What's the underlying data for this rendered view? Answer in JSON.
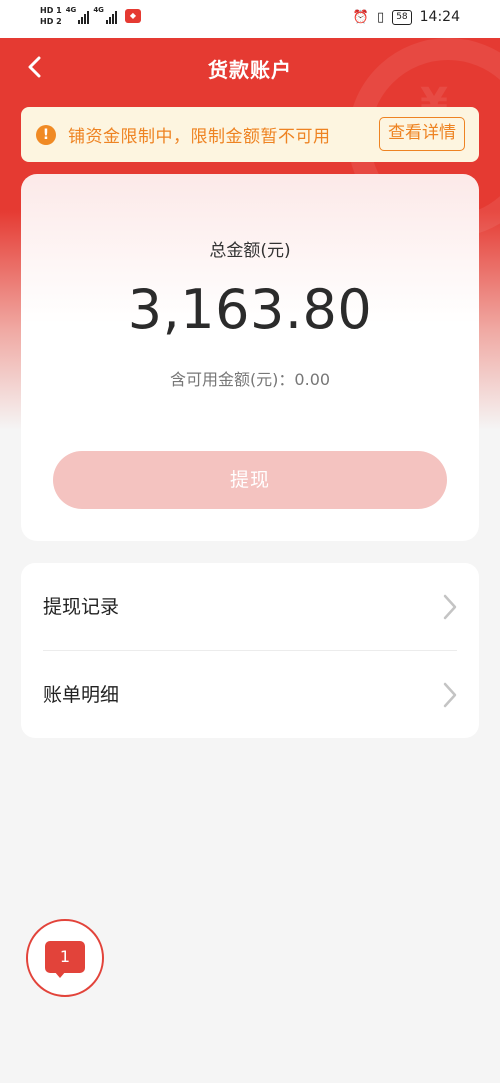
{
  "status_bar": {
    "hd1": "HD 1",
    "hd2": "HD 2",
    "net1": "4G",
    "net2": "4G",
    "battery": "58",
    "time": "14:24",
    "icons": [
      "alarm-icon",
      "vibrate-icon",
      "battery-icon"
    ]
  },
  "nav": {
    "title": "货款账户",
    "back_icon": "chevron-left-icon"
  },
  "notice": {
    "icon": "exclamation-icon",
    "text": "铺资金限制中，限制金额暂不可用",
    "button": "查看详情"
  },
  "account": {
    "total_label": "总金额(元)",
    "total_amount": "3,163.80",
    "available_text": "含可用金额(元)：0.00",
    "withdraw_button": "提现"
  },
  "menu": {
    "items": [
      {
        "label": "提现记录",
        "icon": "chevron-right-icon"
      },
      {
        "label": "账单明细",
        "icon": "chevron-right-icon"
      }
    ]
  },
  "fab": {
    "badge": "1",
    "icon": "message-icon"
  },
  "colors": {
    "primary_red": "#e53a32",
    "warning_orange": "#ee8322",
    "notice_bg": "#fdf5e0",
    "disabled_button": "#f4c3c0"
  }
}
